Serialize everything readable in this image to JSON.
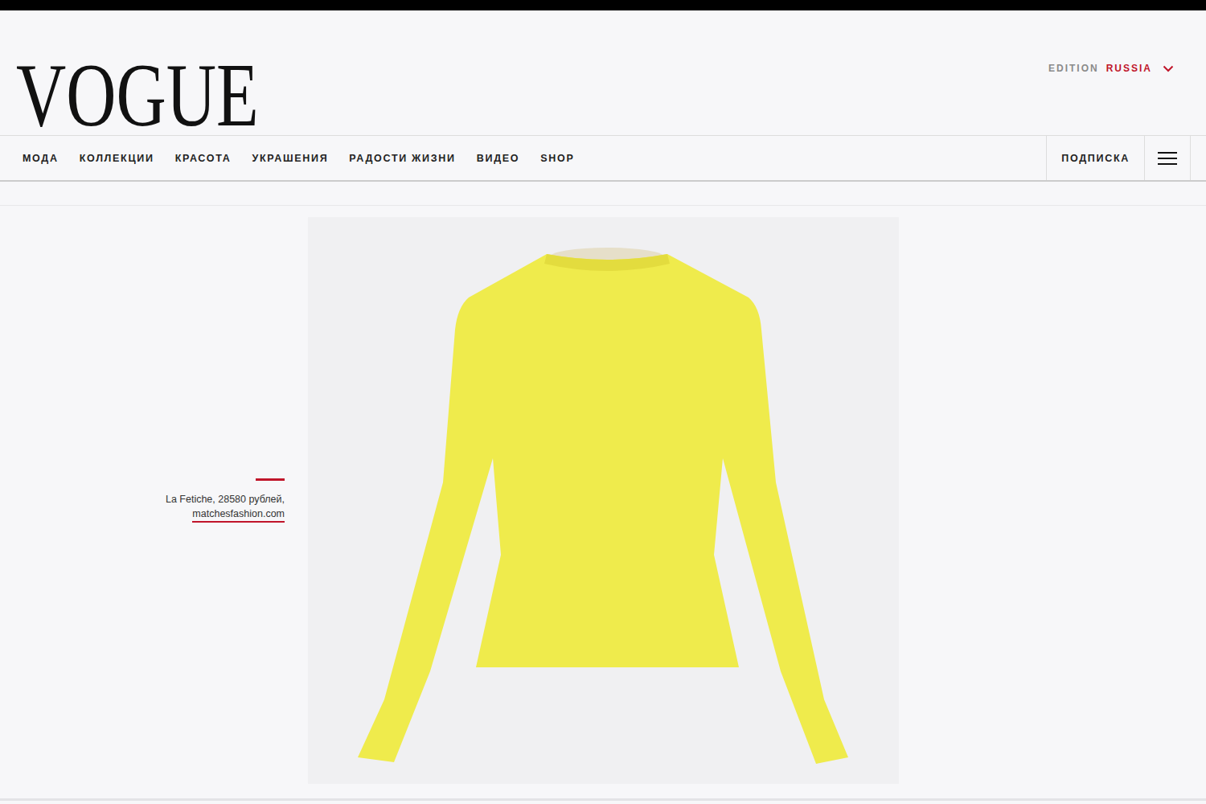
{
  "logo": "VOGUE",
  "edition": {
    "label": "EDITION",
    "value": "RUSSIA"
  },
  "nav": {
    "items": [
      "МОДА",
      "КОЛЛЕКЦИИ",
      "КРАСОТА",
      "УКРАШЕНИЯ",
      "РАДОСТИ ЖИЗНИ",
      "ВИДЕО",
      "SHOP"
    ],
    "subscribe": "ПОДПИСКА"
  },
  "product": {
    "caption": "La Fetiche, 28580 рублей,",
    "link": "matchesfashion.com",
    "color": "#efeb4c"
  }
}
